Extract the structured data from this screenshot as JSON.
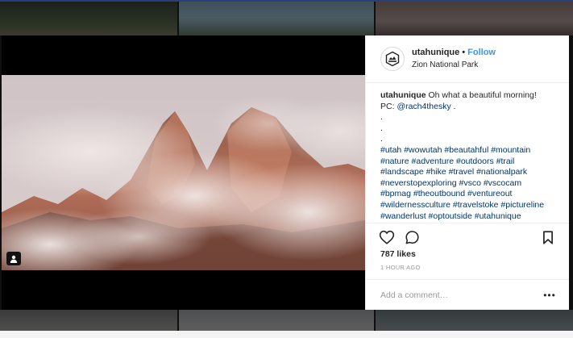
{
  "post": {
    "username": "utahunique",
    "follow_label": "Follow",
    "separator": "•",
    "location": "Zion National Park",
    "caption_text": "Oh what a beautiful morning!",
    "caption_pc": "PC:",
    "caption_mention": "@rach4thesky",
    "caption_end": ".",
    "dots": [
      ".",
      ".",
      "."
    ],
    "hashtag_lines": [
      "#utah #wowutah #beautahful #mountain",
      "#nature #adventure #outdoors #trail",
      "#landscape #hike #travel #nationalpark",
      "#neverstopexploring #vsco #vscocam",
      "#bpmag #theoutbound #ventureout",
      "#wildernessculture #travelstoke #pictureline",
      "#wanderlust #optoutside #utahunique"
    ],
    "likes": "787 likes",
    "time_ago": "1 HOUR AGO",
    "comment_placeholder": "Add a comment…",
    "more_label": "•••"
  },
  "icons": {
    "like": "heart-icon",
    "comment": "comment-bubble-icon",
    "save": "bookmark-icon",
    "user_tag": "user-tag-icon",
    "more": "more-options-icon"
  },
  "colors": {
    "link": "#3897f0",
    "hashtag": "#003569",
    "text": "#262626",
    "muted": "#999999"
  }
}
